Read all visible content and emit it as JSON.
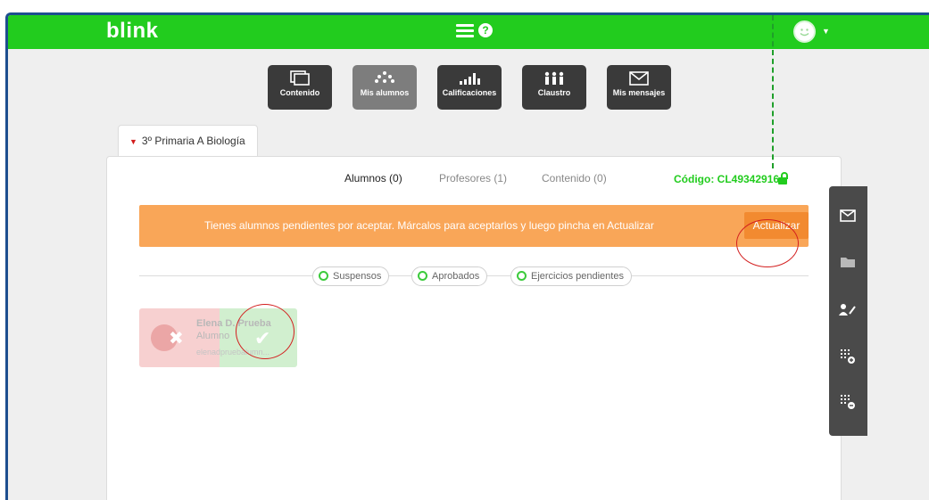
{
  "header": {
    "logo": "blink",
    "help_symbol": "?",
    "menu_icon": "menu-icon",
    "avatar_icon": "avatar-icon"
  },
  "nav": [
    {
      "label": "Contenido",
      "icon": "content-icon"
    },
    {
      "label": "Mis alumnos",
      "icon": "students-icon",
      "active": true
    },
    {
      "label": "Calificaciones",
      "icon": "grades-icon"
    },
    {
      "label": "Claustro",
      "icon": "faculty-icon"
    },
    {
      "label": "Mis mensajes",
      "icon": "mail-icon"
    }
  ],
  "class_tab": {
    "label": "3º Primaria A Biología"
  },
  "subtabs": [
    {
      "label": "Alumnos (0)",
      "active": true
    },
    {
      "label": "Profesores (1)"
    },
    {
      "label": "Contenido (0)"
    }
  ],
  "code": "Código: CL49342916",
  "banner": {
    "message": "Tienes alumnos pendientes por aceptar. Márcalos para aceptarlos y luego pincha en Actualizar",
    "button_label": "Actualizar"
  },
  "filters": [
    "Suspensos",
    "Aprobados",
    "Ejercicios pendientes"
  ],
  "pending_student": {
    "name": "Elena D. Prueba",
    "role": "Alumno",
    "email": "elenadpruebalumn..."
  },
  "sidebar_icons": [
    "mail-icon",
    "folder-icon",
    "edit-user-icon",
    "add-grid-icon",
    "remove-grid-icon"
  ],
  "colors": {
    "brand_green": "#22cc1e",
    "banner_orange": "#f9a658",
    "annotation_red": "#d31f1f",
    "nav_dark": "#3a3a3a"
  }
}
